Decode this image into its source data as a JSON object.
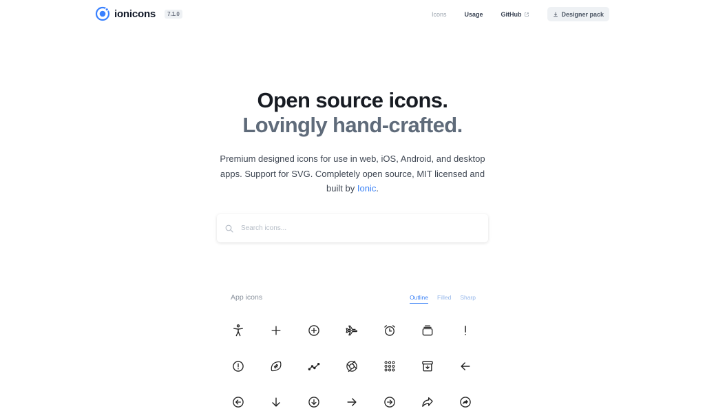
{
  "header": {
    "brand": "ionicons",
    "version": "7.1.0",
    "nav": {
      "icons": "Icons",
      "usage": "Usage",
      "github": "GitHub",
      "designer_pack": "Designer pack"
    }
  },
  "hero": {
    "title": "Open source icons.",
    "subtitle": "Lovingly hand-crafted.",
    "description_pre": "Premium designed icons for use in web, iOS, Android, and desktop apps. Support for SVG. Completely open source, MIT licensed and built by ",
    "description_link": "Ionic",
    "description_post": "."
  },
  "search": {
    "placeholder": "Search icons..."
  },
  "icons_section": {
    "title": "App icons",
    "tabs": [
      "Outline",
      "Filled",
      "Sharp"
    ],
    "active_tab": "Outline"
  },
  "colors": {
    "accent": "#3b82f6",
    "brand": "#3880ff",
    "text_dark": "#171b22",
    "text_muted": "#5f6b7a"
  },
  "icons": [
    "accessibility-icon",
    "add-icon",
    "add-circle-icon",
    "airplane-icon",
    "alarm-icon",
    "albums-icon",
    "alert-icon",
    "alert-circle-icon",
    "american-football-icon",
    "analytics-icon",
    "aperture-icon",
    "apps-icon",
    "archive-icon",
    "arrow-back-icon",
    "arrow-back-circle-icon",
    "arrow-down-icon",
    "arrow-down-circle-icon",
    "arrow-forward-icon",
    "arrow-forward-circle-icon",
    "arrow-redo-icon",
    "arrow-redo-circle-icon"
  ]
}
